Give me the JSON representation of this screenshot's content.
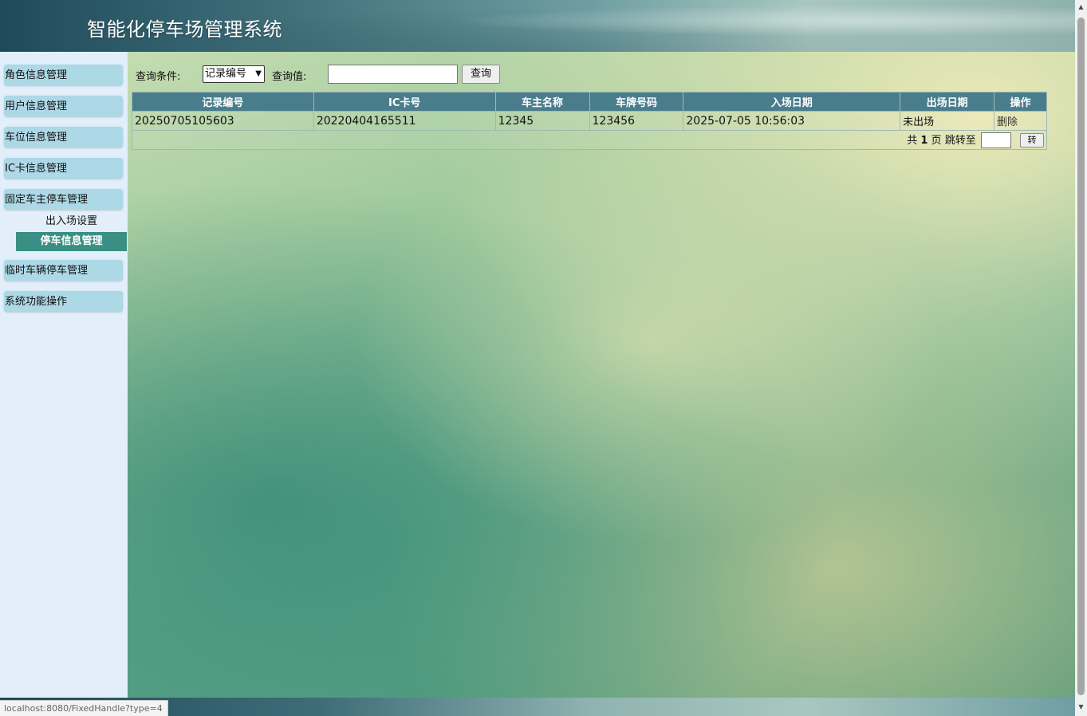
{
  "header": {
    "title": "智能化停车场管理系统"
  },
  "sidebar": {
    "items": [
      {
        "label": "角色信息管理"
      },
      {
        "label": "用户信息管理"
      },
      {
        "label": "车位信息管理"
      },
      {
        "label": "IC卡信息管理"
      },
      {
        "label": "固定车主停车管理"
      },
      {
        "label": "临时车辆停车管理"
      },
      {
        "label": "系统功能操作"
      }
    ],
    "subitems": [
      {
        "label": "出入场设置"
      },
      {
        "label": "停车信息管理",
        "active": true
      }
    ]
  },
  "query": {
    "condition_label": "查询条件:",
    "condition_selected": "记录编号",
    "value_label": "查询值:",
    "value": "",
    "button_label": "查询"
  },
  "table": {
    "headers": [
      "记录编号",
      "IC卡号",
      "车主名称",
      "车牌号码",
      "入场日期",
      "出场日期",
      "操作"
    ],
    "rows": [
      {
        "record_no": "20250705105603",
        "ic_card": "20220404165511",
        "owner": "12345",
        "plate": "123456",
        "entry_date": "2025-07-05 10:56:03",
        "exit_date": "未出场",
        "action": "删除"
      }
    ]
  },
  "pager": {
    "total_prefix": "共",
    "total_pages": "1",
    "total_suffix": "页",
    "jump_label": "跳转至",
    "jump_value": "",
    "go_button": "转"
  },
  "status_bar": {
    "url": "localhost:8080/FixedHandle?type=4"
  },
  "colors": {
    "menu_bg": "#add8e6",
    "active_submenu": "#3a8f84",
    "table_header": "#4a7d8c",
    "sidebar_bg": "#e2effb"
  }
}
